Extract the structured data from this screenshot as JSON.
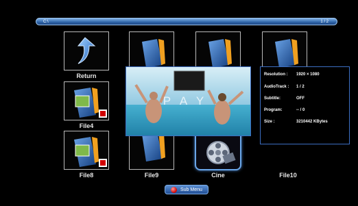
{
  "path_bar": {
    "path": "C:\\",
    "page": "1 / 2"
  },
  "tiles": [
    {
      "label": "Return",
      "icon": "return-arrow-icon"
    },
    {
      "label": "",
      "icon": "folder-icon"
    },
    {
      "label": "",
      "icon": "folder-icon"
    },
    {
      "label": "",
      "icon": "folder-icon"
    },
    {
      "label": "File4",
      "icon": "photo-folder-icon"
    },
    {
      "label": "File8",
      "icon": "photo-folder-icon"
    },
    {
      "label": "File9",
      "icon": "folder-icon"
    },
    {
      "label": "Cine",
      "icon": "film-reel-icon"
    },
    {
      "label": "File10",
      "icon": "folder-icon"
    }
  ],
  "preview": {
    "overlay_text": "PAY"
  },
  "info": {
    "resolution_label": "Resolution :",
    "resolution_value": "1920 × 1080",
    "audio_label": "AudioTrack :",
    "audio_value": "1 / 2",
    "subtitle_label": "Subtitle:",
    "subtitle_value": "OFF",
    "program_label": "Program:",
    "program_value": "-- / 0",
    "size_label": "Size :",
    "size_value": "3210442 KBytes"
  },
  "submenu": {
    "label": "Sub Menu"
  },
  "colors": {
    "accent": "#3d6fc4",
    "bar": "#2e64a8"
  }
}
